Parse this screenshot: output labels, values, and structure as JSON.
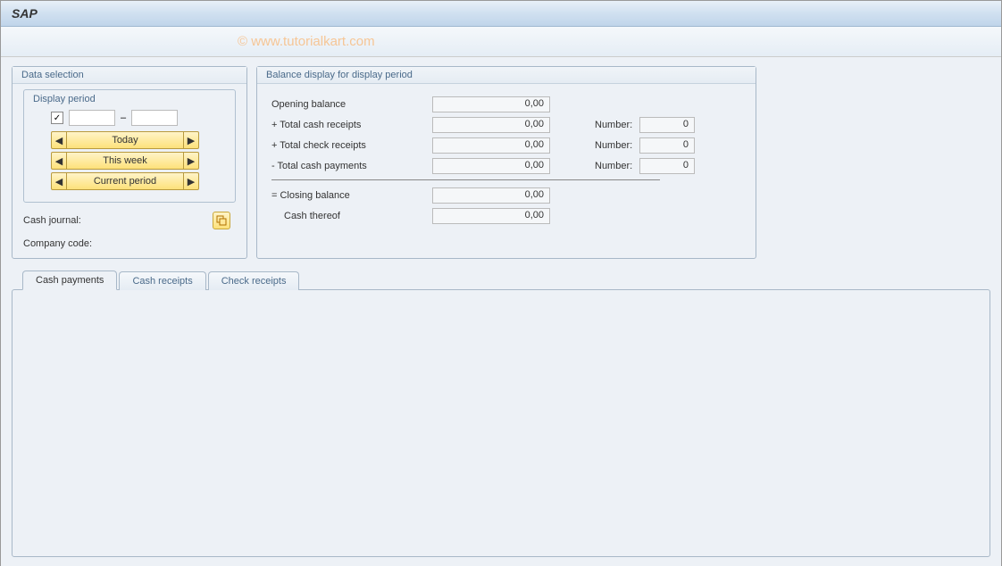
{
  "title": "SAP",
  "watermark": "© www.tutorialkart.com",
  "dataSelection": {
    "title": "Data selection",
    "displayPeriod": {
      "title": "Display period",
      "from": "",
      "to": "",
      "buttons": {
        "today": "Today",
        "thisWeek": "This week",
        "currentPeriod": "Current period"
      }
    },
    "cashJournalLabel": "Cash journal:",
    "companyCodeLabel": "Company code:"
  },
  "balanceDisplay": {
    "title": "Balance display for display period",
    "rows": {
      "openingBalance": {
        "label": "Opening balance",
        "value": "0,00"
      },
      "totalCashReceipts": {
        "label": "+ Total cash receipts",
        "value": "0,00",
        "numberLabel": "Number:",
        "number": "0"
      },
      "totalCheckReceipts": {
        "label": "+ Total check receipts",
        "value": "0,00",
        "numberLabel": "Number:",
        "number": "0"
      },
      "totalCashPayments": {
        "label": "- Total cash payments",
        "value": "0,00",
        "numberLabel": "Number:",
        "number": "0"
      },
      "closingBalance": {
        "label": "= Closing balance",
        "value": "0,00"
      },
      "cashThereof": {
        "label": "Cash thereof",
        "value": "0,00"
      }
    }
  },
  "tabs": {
    "cashPayments": "Cash payments",
    "cashReceipts": "Cash receipts",
    "checkReceipts": "Check receipts"
  }
}
